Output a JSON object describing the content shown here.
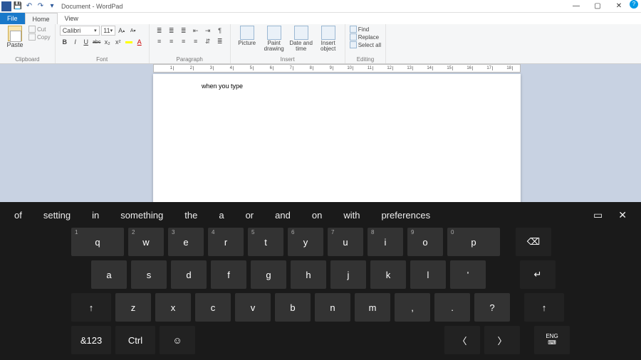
{
  "window": {
    "title": "Document - WordPad",
    "help": "?"
  },
  "qat": {
    "save": "💾",
    "undo": "↶",
    "redo": "↷",
    "more": "▾"
  },
  "win_controls": {
    "min": "—",
    "max": "▢",
    "close": "✕"
  },
  "tabs": {
    "file": "File",
    "home": "Home",
    "view": "View"
  },
  "ribbon": {
    "clipboard": {
      "paste": "Paste",
      "cut": "Cut",
      "copy": "Copy",
      "label": "Clipboard"
    },
    "font": {
      "name": "Calibri",
      "size": "11",
      "grow": "A",
      "shrink": "A",
      "bold": "B",
      "italic": "I",
      "underline": "U",
      "strike": "abc",
      "sub": "x₂",
      "sup": "x²",
      "hl": "▦",
      "color": "A",
      "label": "Font"
    },
    "paragraph": {
      "label": "Paragraph",
      "icons": [
        "≣",
        "≣",
        "≣",
        "⇤",
        "⇥",
        "¶",
        "≡",
        "≡",
        "≡",
        "≡",
        "⇵",
        "≣"
      ]
    },
    "insert": {
      "picture": "Picture",
      "paint": "Paint drawing",
      "date": "Date and time",
      "object": "Insert object",
      "label": "Insert"
    },
    "editing": {
      "find": "Find",
      "replace": "Replace",
      "select": "Select all",
      "label": "Editing"
    }
  },
  "ruler": [
    "1",
    "2",
    "3",
    "4",
    "5",
    "6",
    "7",
    "8",
    "9",
    "10",
    "11",
    "12",
    "13",
    "14",
    "15",
    "16",
    "17",
    "18"
  ],
  "document": {
    "text": "when you type"
  },
  "osk": {
    "suggestions": [
      "of",
      "setting",
      "in",
      "something",
      "the",
      "a",
      "or",
      "and",
      "on",
      "with",
      "preferences"
    ],
    "tool_dock": "▭",
    "tool_close": "✕",
    "rows": {
      "r1": [
        {
          "num": "1",
          "k": "q"
        },
        {
          "num": "2",
          "k": "w"
        },
        {
          "num": "3",
          "k": "e"
        },
        {
          "num": "4",
          "k": "r"
        },
        {
          "num": "5",
          "k": "t"
        },
        {
          "num": "6",
          "k": "y"
        },
        {
          "num": "7",
          "k": "u"
        },
        {
          "num": "8",
          "k": "i"
        },
        {
          "num": "9",
          "k": "o"
        },
        {
          "num": "0",
          "k": "p"
        }
      ],
      "r1_back": "⌫",
      "r2": [
        "a",
        "s",
        "d",
        "f",
        "g",
        "h",
        "j",
        "k",
        "l",
        "'"
      ],
      "r2_enter": "↵",
      "r3_shift": "↑",
      "r3": [
        "z",
        "x",
        "c",
        "v",
        "b",
        "n",
        "m",
        ",",
        ".",
        "?"
      ],
      "r3_shift2": "↑",
      "r4": {
        "sym": "&123",
        "ctrl": "Ctrl",
        "emoji": "☺",
        "left": "〈",
        "right": "〉",
        "lang_top": "ENG",
        "lang_icon": "⌨"
      }
    }
  }
}
